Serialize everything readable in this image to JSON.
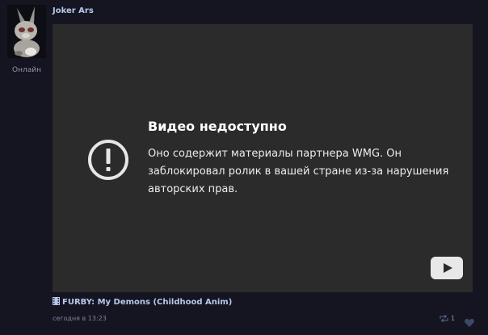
{
  "post": {
    "author": "Joker Ars",
    "status": "Онлайн",
    "video_title": "FURBY: My Demons (Childhood Anim)",
    "timestamp": "сегодня в 13:23",
    "repost_count": "1"
  },
  "video": {
    "error_title": "Видео недоступно",
    "error_message": "Оно содержит материалы партнера WMG. Он заблокировал ролик в вашей стране из-за нарушения авторских прав.",
    "play_icon": "youtube-play-icon"
  },
  "colors": {
    "background": "#151522",
    "player": "#2b2b2b",
    "link": "#b8c8e8",
    "muted": "#7c8496"
  }
}
